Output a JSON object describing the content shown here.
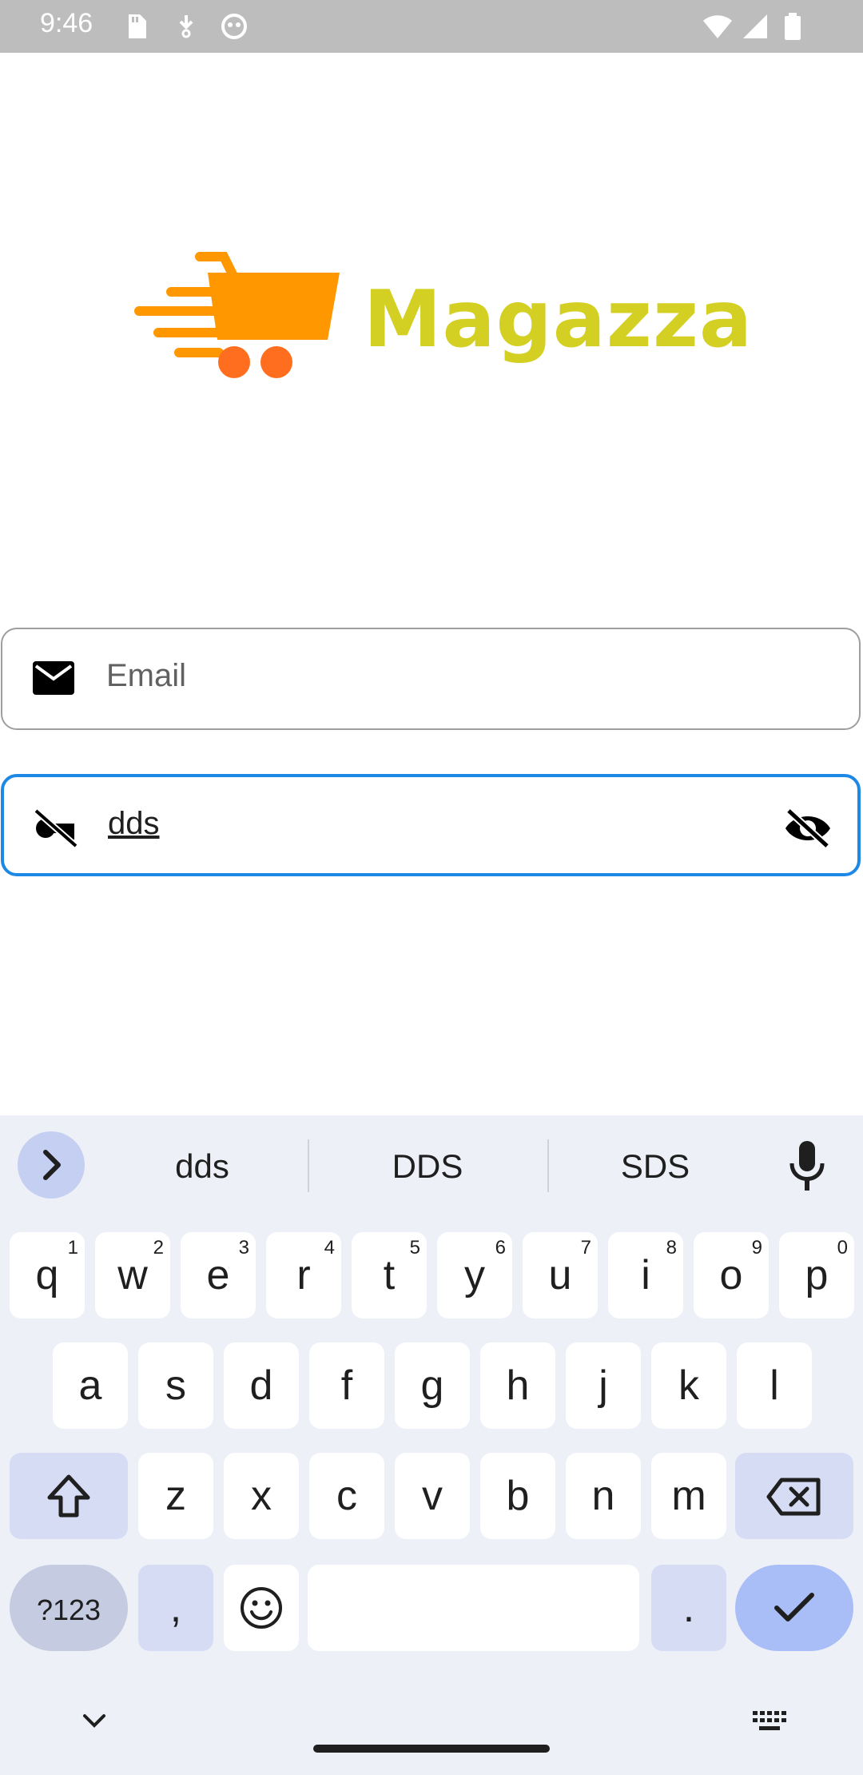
{
  "status_bar": {
    "time": "9:46"
  },
  "logo": {
    "text": "Magazza"
  },
  "form": {
    "email": {
      "placeholder": "Email",
      "value": ""
    },
    "password": {
      "value": "dds"
    }
  },
  "keyboard": {
    "suggestions": [
      "dds",
      "DDS",
      "SDS"
    ],
    "row1": [
      {
        "key": "q",
        "alt": "1"
      },
      {
        "key": "w",
        "alt": "2"
      },
      {
        "key": "e",
        "alt": "3"
      },
      {
        "key": "r",
        "alt": "4"
      },
      {
        "key": "t",
        "alt": "5"
      },
      {
        "key": "y",
        "alt": "6"
      },
      {
        "key": "u",
        "alt": "7"
      },
      {
        "key": "i",
        "alt": "8"
      },
      {
        "key": "o",
        "alt": "9"
      },
      {
        "key": "p",
        "alt": "0"
      }
    ],
    "row2": [
      "a",
      "s",
      "d",
      "f",
      "g",
      "h",
      "j",
      "k",
      "l"
    ],
    "row3": [
      "z",
      "x",
      "c",
      "v",
      "b",
      "n",
      "m"
    ],
    "symbols_label": "?123",
    "comma": ",",
    "period": ".",
    "colors": {
      "background": "#eef0f8",
      "accent": "#a9bdf7",
      "modifier": "#d6dcf3"
    }
  },
  "colors": {
    "logo_cart": "#ff9800",
    "logo_text": "#d4d023",
    "focus_border": "#1e88e5"
  }
}
